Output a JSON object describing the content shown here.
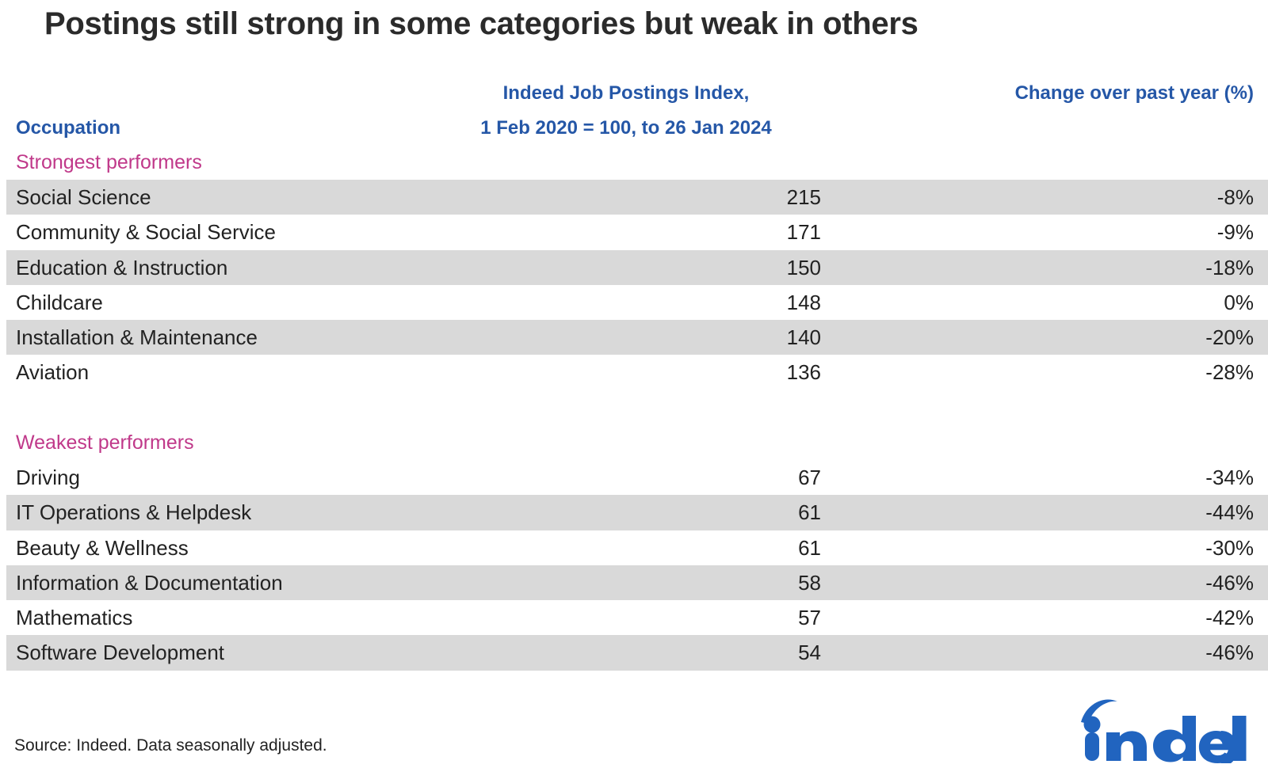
{
  "title": "Postings still strong in some categories but weak in others",
  "headers": {
    "occupation": "Occupation",
    "index_line1": "Indeed Job Postings Index,",
    "index_line2": "1 Feb 2020 = 100, to 26 Jan 2024",
    "change": "Change over past year (%)"
  },
  "sections": [
    {
      "label": "Strongest performers",
      "rows": [
        {
          "occupation": "Social Science",
          "index": "215",
          "change": "-8%"
        },
        {
          "occupation": "Community & Social Service",
          "index": "171",
          "change": "-9%"
        },
        {
          "occupation": "Education & Instruction",
          "index": "150",
          "change": "-18%"
        },
        {
          "occupation": "Childcare",
          "index": "148",
          "change": "0%"
        },
        {
          "occupation": "Installation & Maintenance",
          "index": "140",
          "change": "-20%"
        },
        {
          "occupation": "Aviation",
          "index": "136",
          "change": "-28%"
        }
      ]
    },
    {
      "label": "Weakest performers",
      "rows": [
        {
          "occupation": "Driving",
          "index": "67",
          "change": "-34%"
        },
        {
          "occupation": "IT Operations & Helpdesk",
          "index": "61",
          "change": "-44%"
        },
        {
          "occupation": "Beauty & Wellness",
          "index": "61",
          "change": "-30%"
        },
        {
          "occupation": "Information & Documentation",
          "index": "58",
          "change": "-46%"
        },
        {
          "occupation": "Mathematics",
          "index": "57",
          "change": "-42%"
        },
        {
          "occupation": "Software Development",
          "index": "54",
          "change": "-46%"
        }
      ]
    }
  ],
  "source": "Source: Indeed. Data seasonally adjusted.",
  "logo_text": "indeed",
  "colors": {
    "header_blue": "#2557a7",
    "section_magenta": "#c0398a",
    "stripe_gray": "#d9d9d9",
    "title_black": "#2b2b2b",
    "logo_blue": "#2164bf"
  },
  "chart_data": {
    "type": "table",
    "title": "Postings still strong in some categories but weak in others",
    "columns": [
      "Occupation",
      "Indeed Job Postings Index, 1 Feb 2020 = 100, to 26 Jan 2024",
      "Change over past year (%)"
    ],
    "groups": [
      {
        "name": "Strongest performers",
        "categories": [
          "Social Science",
          "Community & Social Service",
          "Education & Instruction",
          "Childcare",
          "Installation & Maintenance",
          "Aviation"
        ],
        "index_values": [
          215,
          171,
          150,
          148,
          140,
          136
        ],
        "change_pct": [
          -8,
          -9,
          -18,
          0,
          -20,
          -28
        ]
      },
      {
        "name": "Weakest performers",
        "categories": [
          "Driving",
          "IT Operations & Helpdesk",
          "Beauty & Wellness",
          "Information & Documentation",
          "Mathematics",
          "Software Development"
        ],
        "index_values": [
          67,
          61,
          61,
          58,
          57,
          54
        ],
        "change_pct": [
          -34,
          -44,
          -30,
          -46,
          -42,
          -46
        ]
      }
    ],
    "note": "Source: Indeed. Data seasonally adjusted."
  }
}
